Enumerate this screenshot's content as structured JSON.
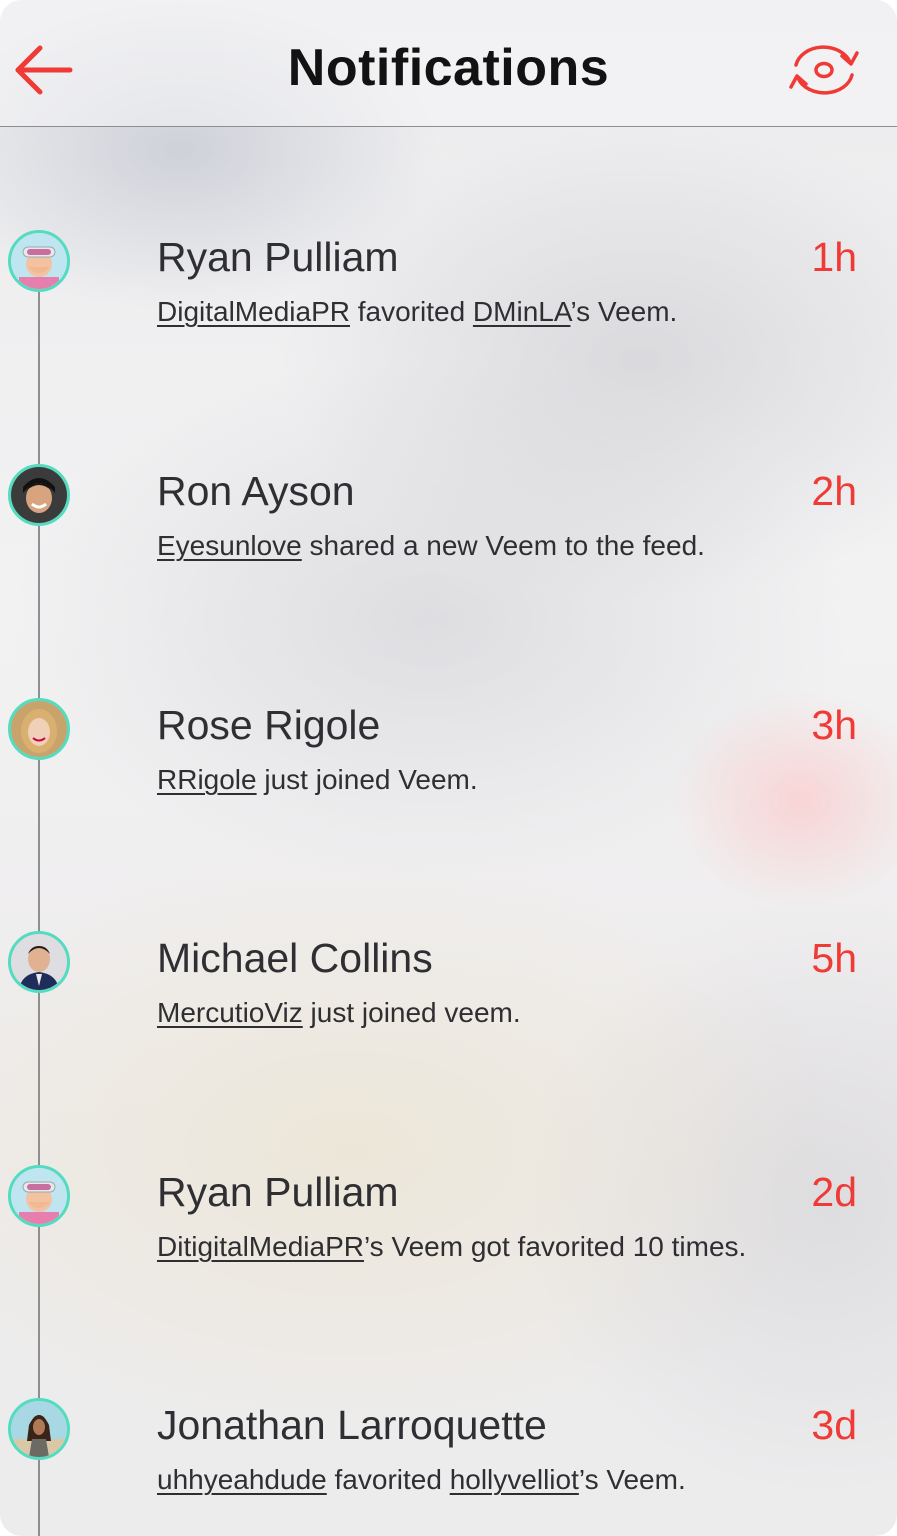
{
  "header": {
    "title": "Notifications",
    "back_icon": "back-arrow-icon",
    "refresh_icon": "refresh-icon"
  },
  "colors": {
    "accent": "#f03a35",
    "avatar_ring": "#52dcc0",
    "text": "#2f2f33"
  },
  "notifications": [
    {
      "name": "Ryan Pulliam",
      "time": "1h",
      "avatar": "avatar-ryan-pulliam",
      "message": [
        {
          "text": "DigitalMediaPR",
          "link": true
        },
        {
          "text": " favorited ",
          "link": false
        },
        {
          "text": "DMinLA",
          "link": true
        },
        {
          "text": "’s Veem.",
          "link": false
        }
      ]
    },
    {
      "name": "Ron Ayson",
      "time": "2h",
      "avatar": "avatar-ron-ayson",
      "message": [
        {
          "text": "Eyesunlove",
          "link": true
        },
        {
          "text": " shared a new Veem to the feed.",
          "link": false
        }
      ]
    },
    {
      "name": "Rose Rigole",
      "time": "3h",
      "avatar": "avatar-rose-rigole",
      "message": [
        {
          "text": "RRigole",
          "link": true
        },
        {
          "text": " just joined Veem.",
          "link": false
        }
      ]
    },
    {
      "name": "Michael Collins",
      "time": "5h",
      "avatar": "avatar-michael-collins",
      "message": [
        {
          "text": "MercutioViz",
          "link": true
        },
        {
          "text": " just joined veem.",
          "link": false
        }
      ]
    },
    {
      "name": "Ryan Pulliam",
      "time": "2d",
      "avatar": "avatar-ryan-pulliam",
      "message": [
        {
          "text": "DitigitalMediaPR",
          "link": true
        },
        {
          "text": "’s Veem got favorited 10 times.",
          "link": false
        }
      ]
    },
    {
      "name": "Jonathan Larroquette",
      "time": "3d",
      "avatar": "avatar-jonathan-larroquette",
      "message": [
        {
          "text": "uhhyeahdude",
          "link": true
        },
        {
          "text": " favorited ",
          "link": false
        },
        {
          "text": "hollyvelliot",
          "link": true
        },
        {
          "text": "’s Veem.",
          "link": false
        }
      ]
    }
  ]
}
